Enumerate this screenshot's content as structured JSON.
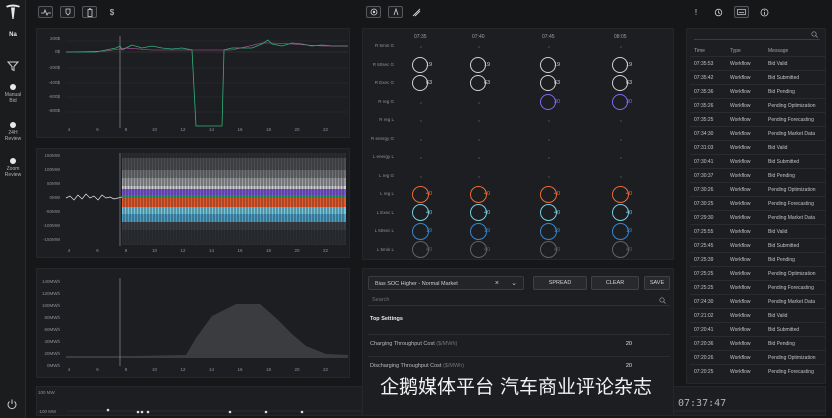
{
  "sidebar": {
    "user": "Na",
    "items": [
      {
        "label_1": "Manual",
        "label_2": "Bid"
      },
      {
        "label_1": "24H",
        "label_2": "Review"
      },
      {
        "label_1": "Zoom",
        "label_2": "Review"
      }
    ]
  },
  "toolbar": {
    "left_icons": [
      "pulse-icon",
      "tag-icon",
      "battery-icon",
      "dollar-icon"
    ],
    "center_icons": [
      "target-icon",
      "run-icon",
      "signal-icon"
    ],
    "right_icons": [
      "alert-icon",
      "history-icon",
      "keyboard-icon",
      "info-icon"
    ]
  },
  "charts": {
    "price": {
      "y_ticks": [
        "200$",
        "0$",
        "-200$",
        "-400$",
        "-600$",
        "-800$"
      ],
      "x_ticks": [
        "4",
        "6",
        "8",
        "10",
        "12",
        "14",
        "16",
        "18",
        "20",
        "22"
      ]
    },
    "power": {
      "y_ticks": [
        "150MW",
        "100MW",
        "50MW",
        "0MW",
        "-50MW",
        "-100MW",
        "-150MW"
      ],
      "x_ticks": [
        "4",
        "6",
        "8",
        "10",
        "12",
        "14",
        "16",
        "18",
        "20",
        "22"
      ]
    },
    "energy": {
      "y_ticks": [
        "140MWh",
        "120MWh",
        "100MWh",
        "80MWh",
        "60MWh",
        "40MWh",
        "20MWh",
        "0MWh"
      ],
      "x_ticks": [
        "4",
        "6",
        "8",
        "10",
        "12",
        "14",
        "16",
        "18",
        "20",
        "22"
      ]
    },
    "bottom": {
      "y_ticks": [
        "100 MW",
        "-100 MW"
      ]
    }
  },
  "bid_grid": {
    "times": [
      "07:35",
      "07:40",
      "07:45",
      "08:05"
    ],
    "rows": [
      {
        "label": "R 5min G",
        "values": [
          "",
          "",
          "",
          ""
        ],
        "color": ""
      },
      {
        "label": "R 60sec G",
        "values": [
          "19",
          "19",
          "19",
          "19"
        ],
        "color": "#cfd2d5"
      },
      {
        "label": "R Exec G",
        "values": [
          "63",
          "63",
          "63",
          "63"
        ],
        "color": "#cfd2d5"
      },
      {
        "label": "R reg G",
        "values": [
          "",
          "",
          "30",
          "30"
        ],
        "color": "#7b6cf2"
      },
      {
        "label": "R reg L",
        "values": [
          "",
          "",
          "",
          ""
        ],
        "color": ""
      },
      {
        "label": "R energy G",
        "values": [
          "",
          "",
          "",
          ""
        ],
        "color": ""
      },
      {
        "label": "L energy L",
        "values": [
          "",
          "",
          "",
          ""
        ],
        "color": ""
      },
      {
        "label": "L reg G",
        "values": [
          "",
          "",
          "",
          ""
        ],
        "color": ""
      },
      {
        "label": "L reg L",
        "values": [
          "40",
          "40",
          "40",
          "40"
        ],
        "color": "#f06a2e"
      },
      {
        "label": "L Exec L",
        "values": [
          "40",
          "40",
          "40",
          "40"
        ],
        "color": "#6fd0ea"
      },
      {
        "label": "L 60sec L",
        "values": [
          "19",
          "19",
          "19",
          "19"
        ],
        "color": "#3c86c9"
      },
      {
        "label": "L 5min L",
        "values": [
          "40",
          "40",
          "40",
          "40"
        ],
        "color": "#5f6368"
      }
    ]
  },
  "settings": {
    "selected_strategy": "Bias SOC Higher - Normal Market",
    "spread_label": "SPREAD",
    "clear_label": "CLEAR",
    "save_label": "SAVE",
    "search_placeholder": "Search",
    "section_title": "Top Settings",
    "rows": [
      {
        "label": "Charging Throughput Cost",
        "unit": "($/MWh)",
        "value": "20"
      },
      {
        "label": "Discharging Throughput Cost",
        "unit": "($/MWh)",
        "value": "20"
      }
    ]
  },
  "log": {
    "headers": [
      "Time",
      "Type",
      "Message"
    ],
    "rows": [
      [
        "07:35:53",
        "Workflow",
        "Bid Valid"
      ],
      [
        "07:35:42",
        "Workflow",
        "Bid Submitted"
      ],
      [
        "07:35:36",
        "Workflow",
        "Bid Pending"
      ],
      [
        "07:35:26",
        "Workflow",
        "Pending Optimization"
      ],
      [
        "07:35:25",
        "Workflow",
        "Pending Forecasting"
      ],
      [
        "07:34:30",
        "Workflow",
        "Pending Market Data"
      ],
      [
        "07:31:03",
        "Workflow",
        "Bid Valid"
      ],
      [
        "07:30:41",
        "Workflow",
        "Bid Submitted"
      ],
      [
        "07:30:37",
        "Workflow",
        "Bid Pending"
      ],
      [
        "07:30:26",
        "Workflow",
        "Pending Optimization"
      ],
      [
        "07:30:25",
        "Workflow",
        "Pending Forecasting"
      ],
      [
        "07:29:30",
        "Workflow",
        "Pending Market Data"
      ],
      [
        "07:25:55",
        "Workflow",
        "Bid Valid"
      ],
      [
        "07:25:45",
        "Workflow",
        "Bid Submitted"
      ],
      [
        "07:25:39",
        "Workflow",
        "Bid Pending"
      ],
      [
        "07:25:25",
        "Workflow",
        "Pending Optimization"
      ],
      [
        "07:25:25",
        "Workflow",
        "Pending Forecasting"
      ],
      [
        "07:24:30",
        "Workflow",
        "Pending Market Data"
      ],
      [
        "07:21:02",
        "Workflow",
        "Bid Valid"
      ],
      [
        "07:20:41",
        "Workflow",
        "Bid Submitted"
      ],
      [
        "07:20:36",
        "Workflow",
        "Bid Pending"
      ],
      [
        "07:20:26",
        "Workflow",
        "Pending Optimization"
      ],
      [
        "07:20:25",
        "Workflow",
        "Pending Forecasting"
      ]
    ]
  },
  "clock": "07:37:47",
  "watermark": "企鹅媒体平台 汽车商业评论杂志"
}
